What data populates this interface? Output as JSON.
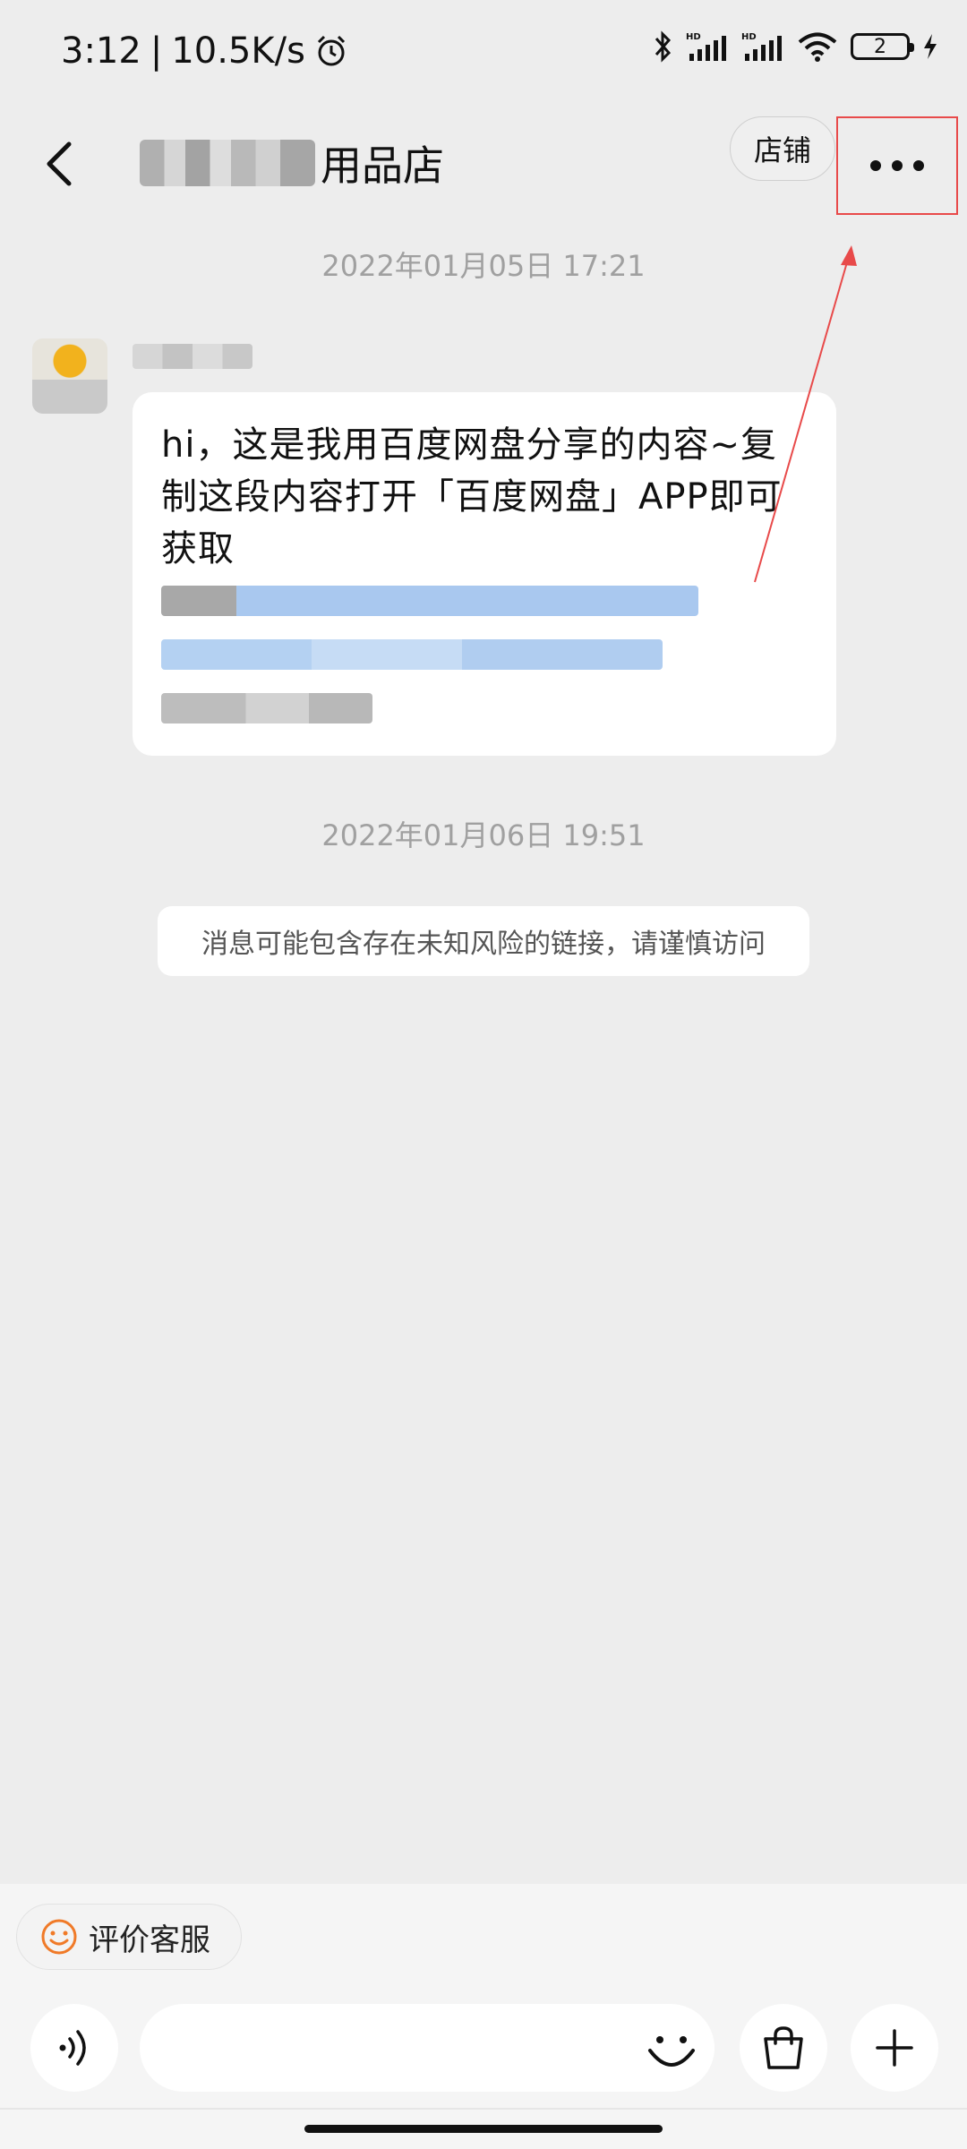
{
  "status_bar": {
    "time": "3:12",
    "net_speed": "10.5K/s",
    "battery_level": "2"
  },
  "header": {
    "store_name_suffix": "用品店",
    "shop_label": "店铺"
  },
  "messages": {
    "timestamp_1": "2022年01月05日 17:21",
    "bubble_text": "hi，这是我用百度网盘分享的内容~复制这段内容打开「百度网盘」APP即可获取",
    "timestamp_2": "2022年01月06日 19:51",
    "notice_text": "消息可能包含存在未知风险的链接，请谨慎访问"
  },
  "bottom": {
    "rate_service_label": "评价客服",
    "input_value": ""
  },
  "colors": {
    "background": "#ededed",
    "annotation_red": "#e84a4a",
    "emoji_orange": "#f07a28"
  },
  "icons": [
    "alarm-icon",
    "bluetooth-icon",
    "signal-icon",
    "wifi-icon",
    "charging-icon",
    "back-arrow-icon",
    "more-icon",
    "smiley-icon",
    "voice-icon",
    "emoji-icon",
    "shopping-bag-icon",
    "plus-icon"
  ]
}
